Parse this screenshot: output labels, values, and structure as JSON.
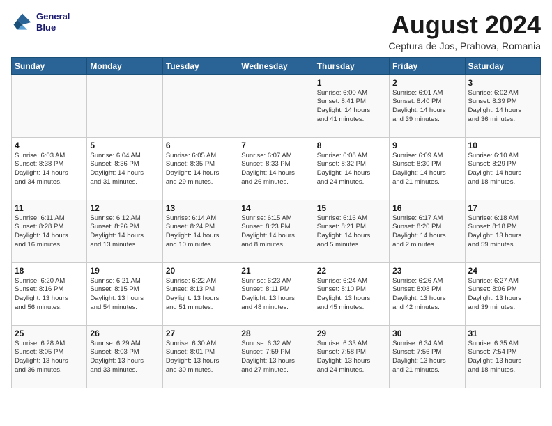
{
  "header": {
    "logo_line1": "General",
    "logo_line2": "Blue",
    "month_year": "August 2024",
    "location": "Ceptura de Jos, Prahova, Romania"
  },
  "days_of_week": [
    "Sunday",
    "Monday",
    "Tuesday",
    "Wednesday",
    "Thursday",
    "Friday",
    "Saturday"
  ],
  "weeks": [
    [
      {
        "day": "",
        "content": ""
      },
      {
        "day": "",
        "content": ""
      },
      {
        "day": "",
        "content": ""
      },
      {
        "day": "",
        "content": ""
      },
      {
        "day": "1",
        "content": "Sunrise: 6:00 AM\nSunset: 8:41 PM\nDaylight: 14 hours\nand 41 minutes."
      },
      {
        "day": "2",
        "content": "Sunrise: 6:01 AM\nSunset: 8:40 PM\nDaylight: 14 hours\nand 39 minutes."
      },
      {
        "day": "3",
        "content": "Sunrise: 6:02 AM\nSunset: 8:39 PM\nDaylight: 14 hours\nand 36 minutes."
      }
    ],
    [
      {
        "day": "4",
        "content": "Sunrise: 6:03 AM\nSunset: 8:38 PM\nDaylight: 14 hours\nand 34 minutes."
      },
      {
        "day": "5",
        "content": "Sunrise: 6:04 AM\nSunset: 8:36 PM\nDaylight: 14 hours\nand 31 minutes."
      },
      {
        "day": "6",
        "content": "Sunrise: 6:05 AM\nSunset: 8:35 PM\nDaylight: 14 hours\nand 29 minutes."
      },
      {
        "day": "7",
        "content": "Sunrise: 6:07 AM\nSunset: 8:33 PM\nDaylight: 14 hours\nand 26 minutes."
      },
      {
        "day": "8",
        "content": "Sunrise: 6:08 AM\nSunset: 8:32 PM\nDaylight: 14 hours\nand 24 minutes."
      },
      {
        "day": "9",
        "content": "Sunrise: 6:09 AM\nSunset: 8:30 PM\nDaylight: 14 hours\nand 21 minutes."
      },
      {
        "day": "10",
        "content": "Sunrise: 6:10 AM\nSunset: 8:29 PM\nDaylight: 14 hours\nand 18 minutes."
      }
    ],
    [
      {
        "day": "11",
        "content": "Sunrise: 6:11 AM\nSunset: 8:28 PM\nDaylight: 14 hours\nand 16 minutes."
      },
      {
        "day": "12",
        "content": "Sunrise: 6:12 AM\nSunset: 8:26 PM\nDaylight: 14 hours\nand 13 minutes."
      },
      {
        "day": "13",
        "content": "Sunrise: 6:14 AM\nSunset: 8:24 PM\nDaylight: 14 hours\nand 10 minutes."
      },
      {
        "day": "14",
        "content": "Sunrise: 6:15 AM\nSunset: 8:23 PM\nDaylight: 14 hours\nand 8 minutes."
      },
      {
        "day": "15",
        "content": "Sunrise: 6:16 AM\nSunset: 8:21 PM\nDaylight: 14 hours\nand 5 minutes."
      },
      {
        "day": "16",
        "content": "Sunrise: 6:17 AM\nSunset: 8:20 PM\nDaylight: 14 hours\nand 2 minutes."
      },
      {
        "day": "17",
        "content": "Sunrise: 6:18 AM\nSunset: 8:18 PM\nDaylight: 13 hours\nand 59 minutes."
      }
    ],
    [
      {
        "day": "18",
        "content": "Sunrise: 6:20 AM\nSunset: 8:16 PM\nDaylight: 13 hours\nand 56 minutes."
      },
      {
        "day": "19",
        "content": "Sunrise: 6:21 AM\nSunset: 8:15 PM\nDaylight: 13 hours\nand 54 minutes."
      },
      {
        "day": "20",
        "content": "Sunrise: 6:22 AM\nSunset: 8:13 PM\nDaylight: 13 hours\nand 51 minutes."
      },
      {
        "day": "21",
        "content": "Sunrise: 6:23 AM\nSunset: 8:11 PM\nDaylight: 13 hours\nand 48 minutes."
      },
      {
        "day": "22",
        "content": "Sunrise: 6:24 AM\nSunset: 8:10 PM\nDaylight: 13 hours\nand 45 minutes."
      },
      {
        "day": "23",
        "content": "Sunrise: 6:26 AM\nSunset: 8:08 PM\nDaylight: 13 hours\nand 42 minutes."
      },
      {
        "day": "24",
        "content": "Sunrise: 6:27 AM\nSunset: 8:06 PM\nDaylight: 13 hours\nand 39 minutes."
      }
    ],
    [
      {
        "day": "25",
        "content": "Sunrise: 6:28 AM\nSunset: 8:05 PM\nDaylight: 13 hours\nand 36 minutes."
      },
      {
        "day": "26",
        "content": "Sunrise: 6:29 AM\nSunset: 8:03 PM\nDaylight: 13 hours\nand 33 minutes."
      },
      {
        "day": "27",
        "content": "Sunrise: 6:30 AM\nSunset: 8:01 PM\nDaylight: 13 hours\nand 30 minutes."
      },
      {
        "day": "28",
        "content": "Sunrise: 6:32 AM\nSunset: 7:59 PM\nDaylight: 13 hours\nand 27 minutes."
      },
      {
        "day": "29",
        "content": "Sunrise: 6:33 AM\nSunset: 7:58 PM\nDaylight: 13 hours\nand 24 minutes."
      },
      {
        "day": "30",
        "content": "Sunrise: 6:34 AM\nSunset: 7:56 PM\nDaylight: 13 hours\nand 21 minutes."
      },
      {
        "day": "31",
        "content": "Sunrise: 6:35 AM\nSunset: 7:54 PM\nDaylight: 13 hours\nand 18 minutes."
      }
    ]
  ]
}
